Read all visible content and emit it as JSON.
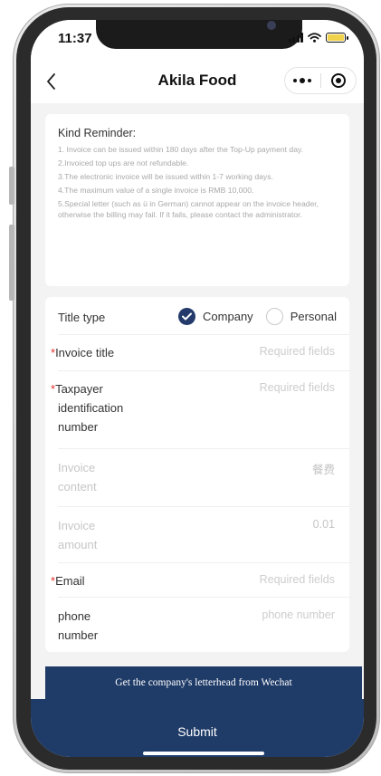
{
  "status_bar": {
    "time": "11:37"
  },
  "navbar": {
    "back_icon": "chevron-left-icon",
    "title": "Akila Food",
    "more_icon": "more-dots-icon",
    "close_icon": "target-icon"
  },
  "reminder": {
    "title": "Kind Reminder:",
    "lines": [
      "1. Invoice can be issued within 180 days after the Top-Up payment day.",
      "2.Invoiced top ups are not refundable.",
      "3.The electronic invoice will be issued within 1-7 working days.",
      "4.The maximum value of a single invoice is RMB 10,000.",
      "5.Special letter (such as ü in German) cannot appear on the invoice header, otherwise the billing may fail. If it fails, please contact the administrator."
    ]
  },
  "form": {
    "title_type": {
      "label": "Title type",
      "options": [
        "Company",
        "Personal"
      ],
      "selected": "Company"
    },
    "invoice_title": {
      "label": "Invoice title",
      "placeholder": "Required fields",
      "required": "*"
    },
    "taxpayer_id": {
      "label_lines": [
        "Taxpayer",
        "identification",
        "number"
      ],
      "placeholder": "Required fields",
      "required": "*"
    },
    "invoice_content": {
      "label_lines": [
        "Invoice",
        "content"
      ],
      "value": "餐费"
    },
    "invoice_amount": {
      "label_lines": [
        "Invoice",
        "amount"
      ],
      "value": "0.01"
    },
    "email": {
      "label": "Email",
      "placeholder": "Required fields",
      "required": "*"
    },
    "phone": {
      "label_lines": [
        "phone",
        "number"
      ],
      "placeholder": "phone number"
    }
  },
  "letterhead_button": "Get the company's letterhead from Wechat",
  "submit_button": "Submit",
  "colors": {
    "accent": "#1f3b68",
    "required": "#e2322c"
  }
}
